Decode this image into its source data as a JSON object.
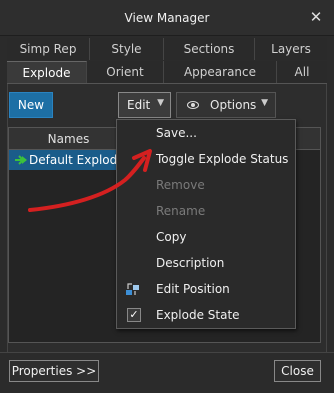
{
  "window": {
    "title": "View Manager",
    "close_glyph": "✕"
  },
  "tabs_row1": [
    "Simp Rep",
    "Style",
    "Sections",
    "Layers"
  ],
  "tabs_row2": [
    "Explode",
    "Orient",
    "Appearance",
    "All"
  ],
  "active_tab": "Explode",
  "toolbar": {
    "new_label": "New",
    "edit_label": "Edit",
    "options_label": "Options"
  },
  "list": {
    "column_header": "Names",
    "rows": [
      {
        "label": "Default Explode",
        "icon": "explode-arrow-icon"
      }
    ]
  },
  "edit_menu": {
    "items": [
      {
        "label": "Save...",
        "enabled": true
      },
      {
        "label": "Toggle Explode Status",
        "enabled": true
      },
      {
        "label": "Remove",
        "enabled": false
      },
      {
        "label": "Rename",
        "enabled": false
      },
      {
        "label": "Copy",
        "enabled": true
      },
      {
        "label": "Description",
        "enabled": true
      },
      {
        "label": "Edit Position",
        "enabled": true,
        "icon": "edit-position-icon"
      },
      {
        "label": "Explode State",
        "enabled": true,
        "checked": true
      }
    ]
  },
  "footer": {
    "properties_label": "Properties >>",
    "close_label": "Close"
  },
  "colors": {
    "accent": "#1d6fa5",
    "selection": "#1a5c8a",
    "annotation_arrow": "#d42020"
  }
}
